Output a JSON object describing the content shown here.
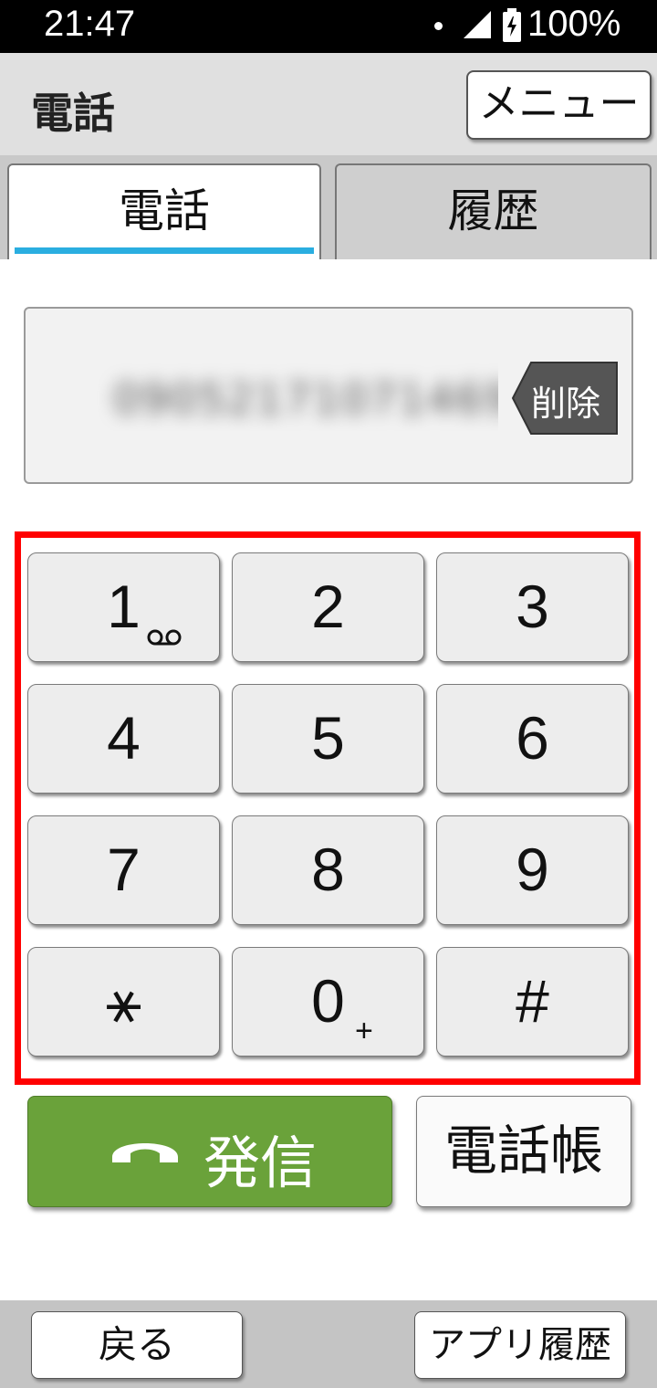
{
  "status_bar": {
    "time": "21:47",
    "battery": "100%"
  },
  "header": {
    "title": "電話",
    "menu_label": "メニュー"
  },
  "tabs": [
    {
      "label": "電話",
      "selected": true
    },
    {
      "label": "履歴",
      "selected": false
    }
  ],
  "dialer": {
    "number": "09052171071469",
    "delete_label": "削除"
  },
  "keypad": {
    "keys": [
      {
        "main": "1",
        "sub": "voicemail"
      },
      {
        "main": "2"
      },
      {
        "main": "3"
      },
      {
        "main": "4"
      },
      {
        "main": "5"
      },
      {
        "main": "6"
      },
      {
        "main": "7"
      },
      {
        "main": "8"
      },
      {
        "main": "9"
      },
      {
        "main": "⚹"
      },
      {
        "main": "0",
        "sub": "+"
      },
      {
        "main": "#"
      }
    ]
  },
  "actions": {
    "call_label": "発信",
    "contacts_label": "電話帳"
  },
  "nav": {
    "back_label": "戻る",
    "recent_apps_label": "アプリ履歴"
  },
  "colors": {
    "call_green": "#6aa23a",
    "tab_indicator": "#2aaee0",
    "highlight_frame": "#ff0000"
  }
}
